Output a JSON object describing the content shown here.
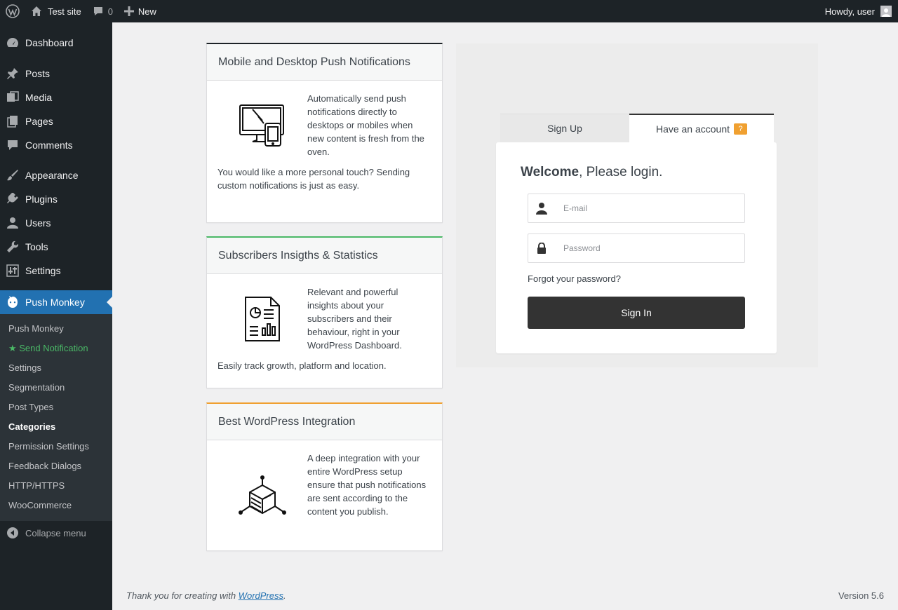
{
  "adminbar": {
    "site_name": "Test site",
    "comments_count": "0",
    "new_label": "New",
    "howdy": "Howdy, user"
  },
  "sidebar": {
    "items": [
      {
        "label": "Dashboard",
        "icon": "dashboard-icon"
      },
      {
        "label": "Posts",
        "icon": "pin-icon"
      },
      {
        "label": "Media",
        "icon": "media-icon"
      },
      {
        "label": "Pages",
        "icon": "pages-icon"
      },
      {
        "label": "Comments",
        "icon": "comment-icon"
      },
      {
        "label": "Appearance",
        "icon": "brush-icon"
      },
      {
        "label": "Plugins",
        "icon": "plug-icon"
      },
      {
        "label": "Users",
        "icon": "user-icon"
      },
      {
        "label": "Tools",
        "icon": "wrench-icon"
      },
      {
        "label": "Settings",
        "icon": "sliders-icon"
      }
    ],
    "current": {
      "label": "Push Monkey",
      "icon": "monkey-icon"
    },
    "submenu": [
      "Push Monkey",
      "★ Send Notification",
      "Settings",
      "Segmentation",
      "Post Types",
      "Categories",
      "Permission Settings",
      "Feedback Dialogs",
      "HTTP/HTTPS",
      "WooCommerce"
    ],
    "collapse_label": "Collapse menu"
  },
  "cards": [
    {
      "title": "Mobile and Desktop Push Notifications",
      "accent": "#1d2327",
      "p1": "Automatically send push notifications directly to desktops or mobiles when new content is fresh from the oven.",
      "p2": "You would like a more personal touch? Sending custom notifications is just as easy."
    },
    {
      "title": "Subscribers Insigths & Statistics",
      "accent": "#4ab866",
      "p1": "Relevant and powerful insights about your subscribers and their behaviour, right in your WordPress Dashboard.",
      "p2": "Easily track growth, platform and location."
    },
    {
      "title": "Best WordPress Integration",
      "accent": "#f0a030",
      "p1": "A deep integration with your entire WordPress setup ensure that push notifications are sent according to the content you publish."
    }
  ],
  "login": {
    "tab_signup": "Sign Up",
    "tab_login": "Have an account",
    "badge": "?",
    "welcome_bold": "Welcome",
    "welcome_rest": ", Please login.",
    "email_placeholder": "E-mail",
    "password_placeholder": "Password",
    "forgot": "Forgot your password?",
    "signin": "Sign In"
  },
  "footer": {
    "thanks_pre": "Thank you for creating with ",
    "thanks_link": "WordPress",
    "thanks_post": ".",
    "version": "Version 5.6"
  }
}
